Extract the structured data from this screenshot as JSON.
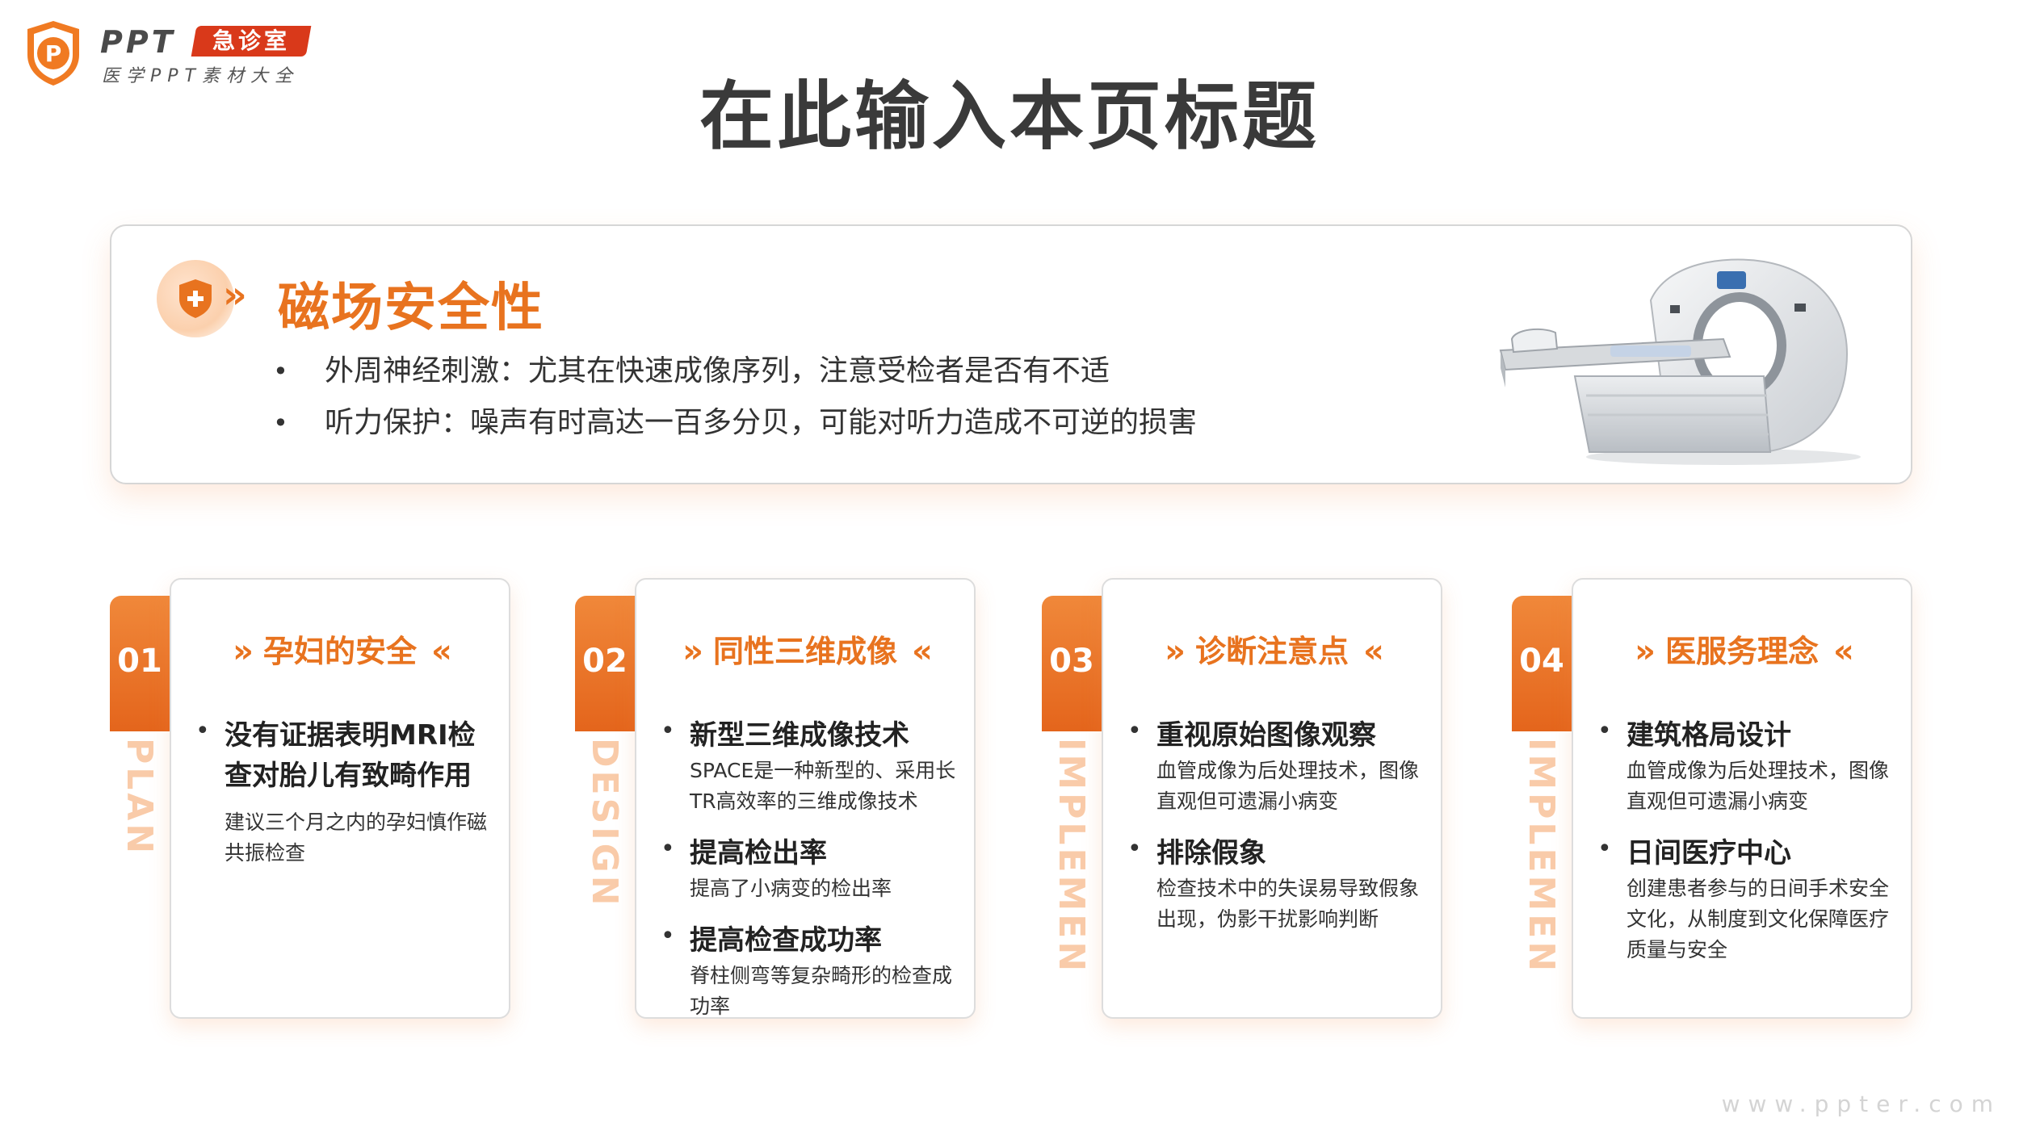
{
  "logo": {
    "brand": "PPT",
    "badge": "急诊室",
    "subtitle": "医学PPT素材大全"
  },
  "page_title": "在此输入本页标题",
  "panel": {
    "heading": "磁场安全性",
    "chevrons": "»",
    "bullets": [
      "外周神经刺激：尤其在快速成像序列，注意受检者是否有不适",
      "听力保护：噪声有时高达一百多分贝，可能对听力造成不可逆的损害"
    ]
  },
  "cards": [
    {
      "number": "01",
      "vertical_label": "PLAN",
      "title": "孕妇的安全",
      "items": [
        {
          "title": "没有证据表明MRI检查对胎儿有致畸作用",
          "desc": "建议三个月之内的孕妇慎作磁共振检查"
        }
      ]
    },
    {
      "number": "02",
      "vertical_label": "DESIGN",
      "title": "同性三维成像",
      "items": [
        {
          "title": "新型三维成像技术",
          "desc": "SPACE是一种新型的、采用长TR高效率的三维成像技术"
        },
        {
          "title": "提高检出率",
          "desc": "提高了小病变的检出率"
        },
        {
          "title": "提高检查成功率",
          "desc": "脊柱侧弯等复杂畸形的检查成功率"
        }
      ]
    },
    {
      "number": "03",
      "vertical_label": "IMPLEMEN",
      "title": "诊断注意点",
      "items": [
        {
          "title": "重视原始图像观察",
          "desc": "血管成像为后处理技术，图像直观但可遗漏小病变"
        },
        {
          "title": "排除假象",
          "desc": "检查技术中的失误易导致假象出现，伪影干扰影响判断"
        }
      ]
    },
    {
      "number": "04",
      "vertical_label": "IMPLEMEN",
      "title": "医服务理念",
      "items": [
        {
          "title": "建筑格局设计",
          "desc": "血管成像为后处理技术，图像直观但可遗漏小病变"
        },
        {
          "title": "日间医疗中心",
          "desc": "创建患者参与的日间手术安全文化，从制度到文化保障医疗质量与安全"
        }
      ]
    }
  ],
  "chevron_left": "»",
  "chevron_right": "«",
  "footer_url": "www.ppter.com",
  "colors": {
    "accent": "#e8731f",
    "accent_dark": "#e4651c",
    "badge_red": "#d9391a",
    "text": "#333333"
  }
}
